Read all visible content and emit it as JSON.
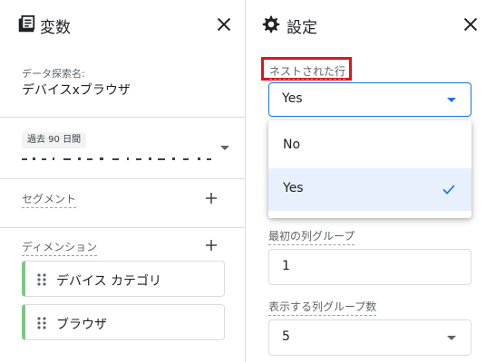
{
  "variables_panel": {
    "title": "変数",
    "exploration_name_label": "データ探索名:",
    "exploration_name": "デバイスxブラウザ",
    "date_range_chip": "過去 90 日間",
    "segments_label": "セグメント",
    "dimensions_label": "ディメンション",
    "dimensions": [
      {
        "label": "デバイス カテゴリ"
      },
      {
        "label": "ブラウザ"
      }
    ]
  },
  "settings_panel": {
    "title": "設定",
    "nested_rows_label": "ネストされた行",
    "nested_rows_value": "Yes",
    "dropdown_options": [
      {
        "label": "No",
        "selected": false
      },
      {
        "label": "Yes",
        "selected": true
      }
    ],
    "first_column_group_label": "最初の列グループ",
    "first_column_group_value": "1",
    "column_groups_shown_label": "表示する列グループ数",
    "column_groups_shown_value": "5"
  },
  "colors": {
    "accent": "#1a73e8",
    "dimension_chip_bar": "#7cc784",
    "highlight_box": "#e0141a",
    "selected_option_bg": "#e8f0fe"
  }
}
